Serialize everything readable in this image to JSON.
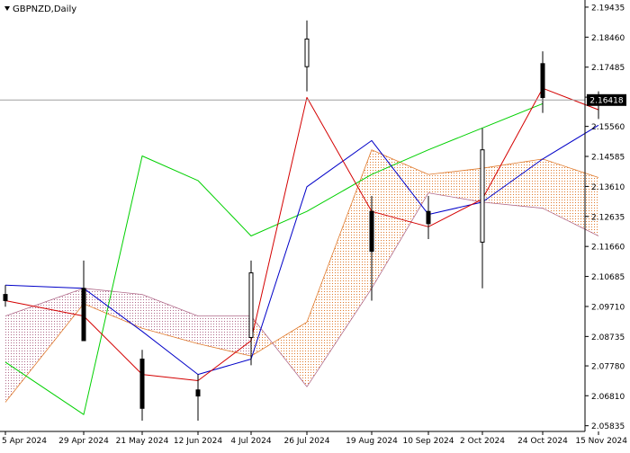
{
  "symbol_label": "GBPNZD,Daily",
  "current_price": "2.16418",
  "colors": {
    "background": "#ffffff",
    "candle": "#000000",
    "tenkan": "#d40000",
    "kijun": "#0000c8",
    "chikou": "#00d000",
    "cloud_bull": "#e07a2c",
    "cloud_bear": "#b06a8a",
    "price_line": "#a0a0a0",
    "price_tag_bg": "#000000",
    "price_tag_text": "#ffffff"
  },
  "chart_data": {
    "type": "candlestick-ichimoku",
    "title": "GBPNZD,Daily",
    "y_ticks": [
      "2.19435",
      "2.18460",
      "2.17485",
      "2.16510",
      "2.15560",
      "2.14585",
      "2.13610",
      "2.12635",
      "2.11660",
      "2.10685",
      "2.09710",
      "2.08735",
      "2.07780",
      "2.06810",
      "2.05835"
    ],
    "ylim": [
      2.0565,
      2.1955
    ],
    "x_ticks": [
      "5 Apr 2024",
      "29 Apr 2024",
      "21 May 2024",
      "12 Jun 2024",
      "4 Jul 2024",
      "26 Jul 2024",
      "19 Aug 2024",
      "10 Sep 2024",
      "2 Oct 2024",
      "24 Oct 2024",
      "15 Nov 2024"
    ],
    "candles": [
      [
        "5 Apr 2024",
        2.101,
        2.104,
        2.097,
        2.099
      ],
      [
        "29 Apr 2024",
        2.103,
        2.112,
        2.089,
        2.086
      ],
      [
        "21 May 2024",
        2.08,
        2.083,
        2.06,
        2.064
      ],
      [
        "12 Jun 2024",
        2.07,
        2.075,
        2.06,
        2.068
      ],
      [
        "4 Jul 2024",
        2.087,
        2.112,
        2.078,
        2.108
      ],
      [
        "26 Jul 2024",
        2.175,
        2.19,
        2.167,
        2.184
      ],
      [
        "19 Aug 2024",
        2.128,
        2.133,
        2.099,
        2.115
      ],
      [
        "10 Sep 2024",
        2.128,
        2.133,
        2.119,
        2.124
      ],
      [
        "2 Oct 2024",
        2.118,
        2.155,
        2.103,
        2.148
      ],
      [
        "24 Oct 2024",
        2.176,
        2.18,
        2.16,
        2.165
      ],
      [
        "15 Nov 2024",
        2.163,
        2.167,
        2.158,
        2.164
      ]
    ],
    "tenkan": [
      [
        "5 Apr 2024",
        2.099
      ],
      [
        "29 Apr 2024",
        2.094
      ],
      [
        "21 May 2024",
        2.075
      ],
      [
        "12 Jun 2024",
        2.073
      ],
      [
        "4 Jul 2024",
        2.086
      ],
      [
        "26 Jul 2024",
        2.165
      ],
      [
        "19 Aug 2024",
        2.128
      ],
      [
        "10 Sep 2024",
        2.123
      ],
      [
        "2 Oct 2024",
        2.132
      ],
      [
        "24 Oct 2024",
        2.168
      ],
      [
        "15 Nov 2024",
        2.161
      ]
    ],
    "kijun": [
      [
        "5 Apr 2024",
        2.104
      ],
      [
        "29 Apr 2024",
        2.103
      ],
      [
        "21 May 2024",
        2.089
      ],
      [
        "12 Jun 2024",
        2.075
      ],
      [
        "4 Jul 2024",
        2.08
      ],
      [
        "26 Jul 2024",
        2.136
      ],
      [
        "19 Aug 2024",
        2.151
      ],
      [
        "10 Sep 2024",
        2.127
      ],
      [
        "2 Oct 2024",
        2.131
      ],
      [
        "24 Oct 2024",
        2.145
      ],
      [
        "15 Nov 2024",
        2.156
      ]
    ],
    "chikou": [
      [
        "5 Apr 2024",
        2.079
      ],
      [
        "29 Apr 2024",
        2.062
      ],
      [
        "21 May 2024",
        2.146
      ],
      [
        "12 Jun 2024",
        2.138
      ],
      [
        "4 Jul 2024",
        2.12
      ],
      [
        "26 Jul 2024",
        2.128
      ],
      [
        "19 Aug 2024",
        2.14
      ],
      [
        "10 Sep 2024",
        2.148
      ],
      [
        "24 Oct 2024",
        2.163
      ]
    ],
    "span_a": [
      [
        "5 Apr 2024",
        2.066
      ],
      [
        "29 Apr 2024",
        2.098
      ],
      [
        "21 May 2024",
        2.09
      ],
      [
        "12 Jun 2024",
        2.085
      ],
      [
        "4 Jul 2024",
        2.081
      ],
      [
        "26 Jul 2024",
        2.092
      ],
      [
        "19 Aug 2024",
        2.148
      ],
      [
        "10 Sep 2024",
        2.14
      ],
      [
        "2 Oct 2024",
        2.142
      ],
      [
        "24 Oct 2024",
        2.145
      ],
      [
        "15 Nov 2024",
        2.139
      ]
    ],
    "span_b": [
      [
        "5 Apr 2024",
        2.094
      ],
      [
        "29 Apr 2024",
        2.103
      ],
      [
        "21 May 2024",
        2.101
      ],
      [
        "12 Jun 2024",
        2.094
      ],
      [
        "4 Jul 2024",
        2.094
      ],
      [
        "26 Jul 2024",
        2.071
      ],
      [
        "19 Aug 2024",
        2.103
      ],
      [
        "10 Sep 2024",
        2.134
      ],
      [
        "2 Oct 2024",
        2.131
      ],
      [
        "24 Oct 2024",
        2.129
      ],
      [
        "15 Nov 2024",
        2.12
      ]
    ],
    "grid": false,
    "legend": "none"
  }
}
